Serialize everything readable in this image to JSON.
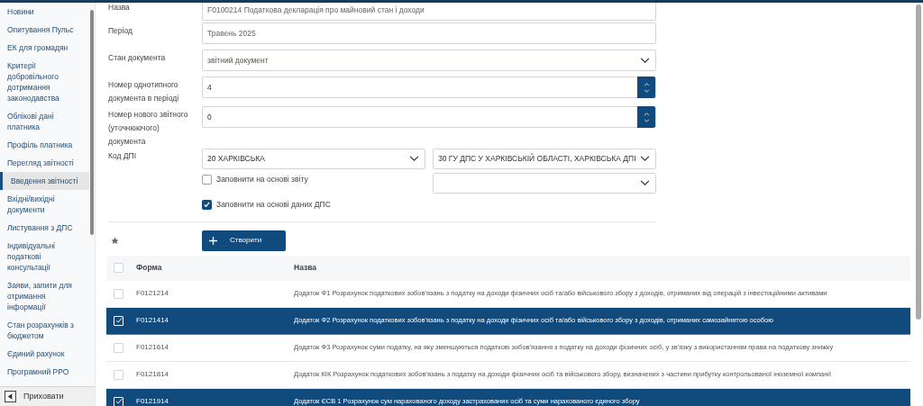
{
  "sidebar": {
    "items": [
      {
        "label": "Новини",
        "selected": false
      },
      {
        "label": "Опитування Пульс",
        "selected": false
      },
      {
        "label": "ЕК для громадян",
        "selected": false
      },
      {
        "label": "Критерії добровільного дотримання законодавства",
        "selected": false
      },
      {
        "label": "Облікові дані платника",
        "selected": false
      },
      {
        "label": "Профіль платника",
        "selected": false
      },
      {
        "label": "Перегляд звітності",
        "selected": false
      },
      {
        "label": "Введення звітності",
        "selected": true
      },
      {
        "label": "Вхідні/вихідні документи",
        "selected": false
      },
      {
        "label": "Листування з ДПС",
        "selected": false
      },
      {
        "label": "Індивідуальні податкові консультації",
        "selected": false
      },
      {
        "label": "Заяви, запити для отримання інформації",
        "selected": false
      },
      {
        "label": "Стан розрахунків з бюджетом",
        "selected": false
      },
      {
        "label": "Єдиний рахунок",
        "selected": false
      },
      {
        "label": "Програмний РРО",
        "selected": false
      }
    ],
    "hide_button": "Приховати"
  },
  "form": {
    "fields": [
      {
        "kind": "text",
        "label": "Назва",
        "value": "F0100214 Податкова декларація про майновий стан і доходи"
      },
      {
        "kind": "text",
        "label": "Період",
        "value": "Травень 2025"
      },
      {
        "kind": "select",
        "label": "Стан документа",
        "value": "звітний документ"
      },
      {
        "kind": "number",
        "label": "Номер однотипного документа в періоді",
        "value": "4"
      },
      {
        "kind": "number",
        "label": "Номер нового звітного (уточнюючого) документа",
        "value": "0"
      }
    ],
    "dpi": {
      "label": "Код ДПІ",
      "region": "20 ХАРКІВСЬКА",
      "office": "30 ГУ ДПС У ХАРКІВСЬКІЙ ОБЛАСТІ, ХАРКІВСЬКА ДПІ"
    },
    "checkboxes": [
      {
        "label": "Заповнити на основі звіту",
        "checked": false
      },
      {
        "label": "Заповнити на основі даних ДПС",
        "checked": true
      }
    ],
    "create_button": "Створити"
  },
  "table": {
    "columns": [
      "Форма",
      "Назва"
    ],
    "header_checked": false,
    "rows": [
      {
        "form": "F0121214",
        "name": "Додаток Ф1 Розрахунок податкових зобов'язань з податку на доходи фізичних осіб та/або військового збору з доходів, отриманих від операцій з інвестиційними активами",
        "selected": false
      },
      {
        "form": "F0121414",
        "name": "Додаток Ф2 Розрахунок податкових зобов'язань з податку на доходи фізичних осіб та/або військового збору з доходів, отриманих самозайнятою особою",
        "selected": true
      },
      {
        "form": "F0121614",
        "name": "Додаток Ф3 Розрахунок суми податку, на яку зменшуються податкові зобов'язання з податку на доходи фізичних осіб, у зв'язку з використанням права на податкову знижку",
        "selected": false
      },
      {
        "form": "F0121814",
        "name": "Додаток КІК Розрахунок податкових зобов'язань з податку на доходи фізичних осіб та військового збору, визначених з частини прибутку контрольованої іноземної компанії",
        "selected": false
      },
      {
        "form": "F0121914",
        "name": "Додаток ЄСВ 1 Розрахунок сум нарахованого доходу застрахованих осіб та суми нарахованого єдиного збору",
        "selected": true
      }
    ]
  }
}
